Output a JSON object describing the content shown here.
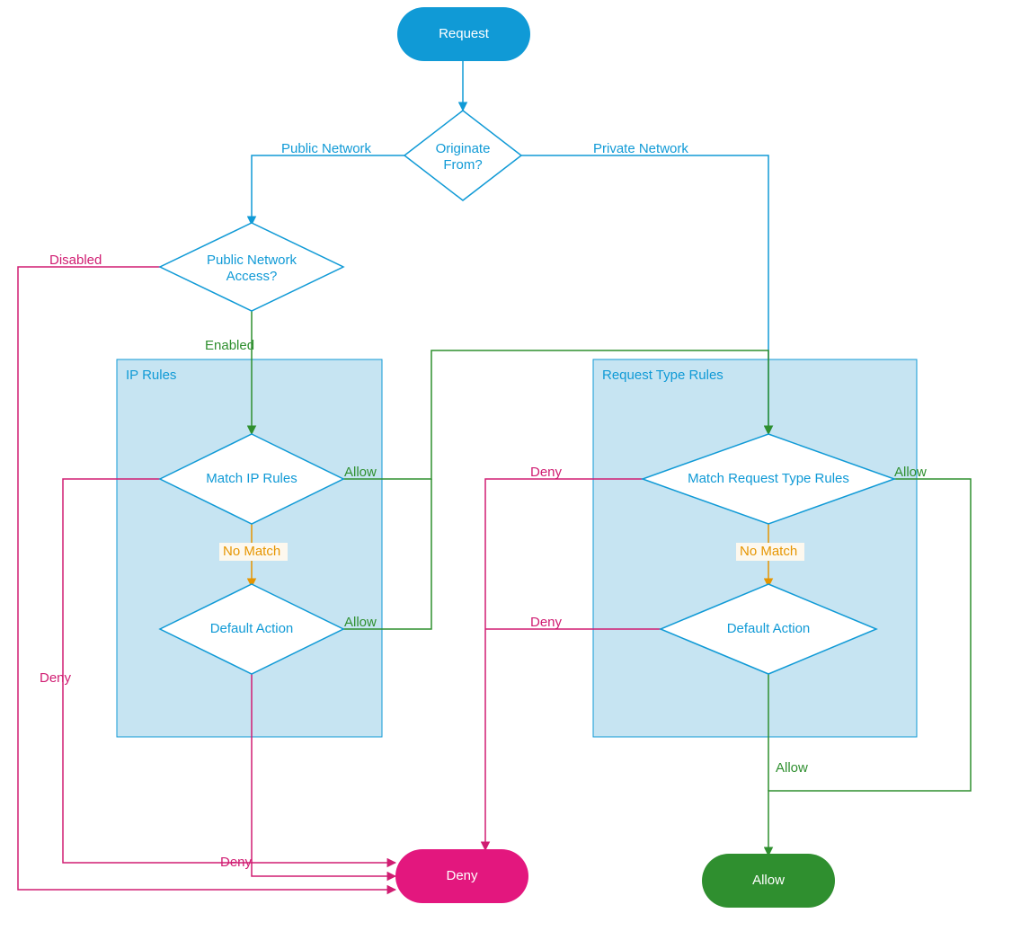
{
  "colors": {
    "blue": "#109ad6",
    "blueFill": "#109ad6",
    "lightBlue": "#c6e4f2",
    "green": "#2f8f2f",
    "orange": "#e69500",
    "magenta": "#d01d72",
    "white": "#ffffff"
  },
  "nodes": {
    "request": "Request",
    "originate": "Originate\nFrom?",
    "pna": "Public Network\nAccess?",
    "ipRulesTitle": "IP Rules",
    "matchIp": "Match IP Rules",
    "defaultIp": "Default Action",
    "rtRulesTitle": "Request Type Rules",
    "matchRt": "Match Request Type Rules",
    "defaultRt": "Default Action",
    "deny": "Deny",
    "allow": "Allow"
  },
  "edges": {
    "publicNet": "Public Network",
    "privateNet": "Private Network",
    "disabled": "Disabled",
    "enabled": "Enabled",
    "noMatch": "No Match",
    "allow": "Allow",
    "deny": "Deny"
  }
}
